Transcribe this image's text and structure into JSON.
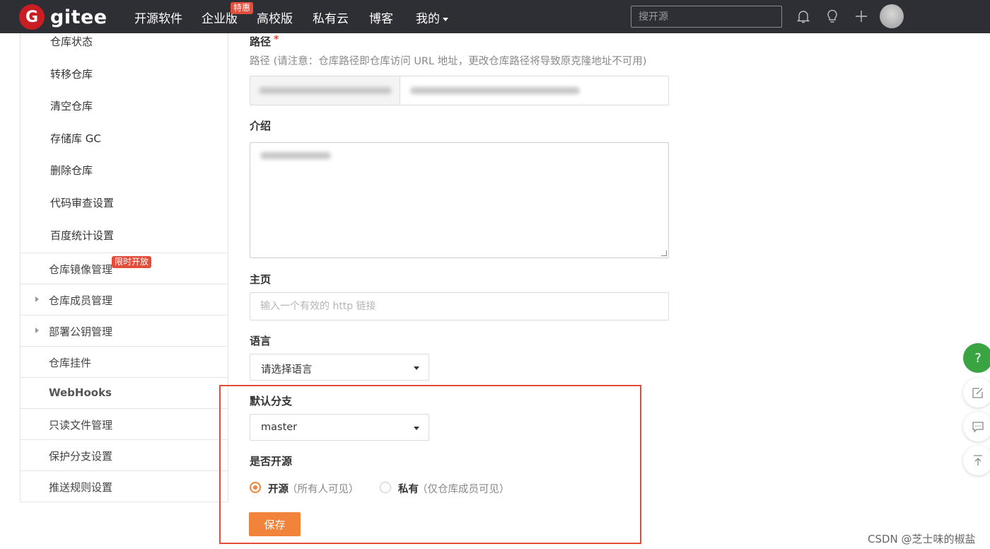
{
  "brand": {
    "logo_letter": "G",
    "name": "gitee"
  },
  "topnav": {
    "items": [
      "开源软件",
      "企业版",
      "高校版",
      "私有云",
      "博客",
      "我的"
    ],
    "promo_badge": "特惠",
    "search_placeholder": "搜开源"
  },
  "sidebar": {
    "sub_items": [
      "仓库状态",
      "转移仓库",
      "清空仓库",
      "存储库 GC",
      "删除仓库",
      "代码审查设置",
      "百度统计设置"
    ],
    "menu": [
      {
        "label": "仓库镜像管理",
        "badge": "限时开放",
        "expandable": false
      },
      {
        "label": "仓库成员管理",
        "expandable": true
      },
      {
        "label": "部署公钥管理",
        "expandable": true
      },
      {
        "label": "仓库挂件",
        "expandable": false
      },
      {
        "label": "WebHooks",
        "expandable": false
      },
      {
        "label": "只读文件管理",
        "expandable": false
      },
      {
        "label": "保护分支设置",
        "expandable": false
      },
      {
        "label": "推送规则设置",
        "expandable": false
      }
    ]
  },
  "form": {
    "path_label": "路径",
    "required_mark": "*",
    "path_hint": "路径 (请注意：仓库路径即仓库访问 URL 地址，更改仓库路径将导致原克隆地址不可用)",
    "intro_label": "介绍",
    "homepage_label": "主页",
    "homepage_placeholder": "输入一个有效的 http 链接",
    "language_label": "语言",
    "language_value": "请选择语言",
    "default_branch_label": "默认分支",
    "default_branch_value": "master",
    "open_source_label": "是否开源",
    "option_public": "开源",
    "option_public_note": "（所有人可见）",
    "option_private": "私有",
    "option_private_note": "（仅仓库成员可见）",
    "save_label": "保存"
  },
  "float_buttons": {
    "help": "?"
  },
  "watermark": "CSDN @芝士味的椒盐",
  "colors": {
    "accent": "#f1833a",
    "nav_bg": "#2e2e35",
    "brand_red": "#c71d23",
    "annotation": "#e34d3c",
    "help_green": "#3aa443"
  }
}
